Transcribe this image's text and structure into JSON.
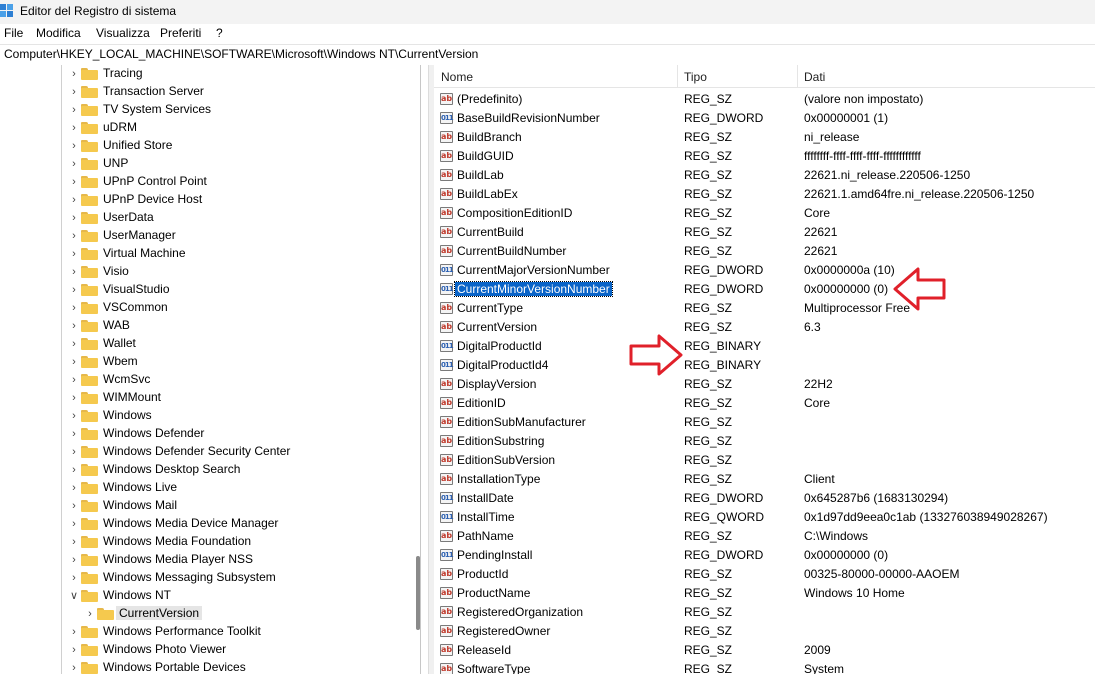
{
  "window": {
    "title": "Editor del Registro di sistema"
  },
  "menu": [
    "File",
    "Modifica",
    "Visualizza",
    "Preferiti",
    "?"
  ],
  "address": "Computer\\HKEY_LOCAL_MACHINE\\SOFTWARE\\Microsoft\\Windows NT\\CurrentVersion",
  "tree": [
    {
      "label": "Tracing",
      "expanded": false
    },
    {
      "label": "Transaction Server",
      "expanded": false
    },
    {
      "label": "TV System Services",
      "expanded": false
    },
    {
      "label": "uDRM",
      "expanded": false
    },
    {
      "label": "Unified Store",
      "expanded": false
    },
    {
      "label": "UNP",
      "expanded": false
    },
    {
      "label": "UPnP Control Point",
      "expanded": false
    },
    {
      "label": "UPnP Device Host",
      "expanded": false
    },
    {
      "label": "UserData",
      "expanded": false
    },
    {
      "label": "UserManager",
      "expanded": false
    },
    {
      "label": "Virtual Machine",
      "expanded": false
    },
    {
      "label": "Visio",
      "expanded": false
    },
    {
      "label": "VisualStudio",
      "expanded": false
    },
    {
      "label": "VSCommon",
      "expanded": false
    },
    {
      "label": "WAB",
      "expanded": false
    },
    {
      "label": "Wallet",
      "expanded": false
    },
    {
      "label": "Wbem",
      "expanded": false
    },
    {
      "label": "WcmSvc",
      "expanded": false
    },
    {
      "label": "WIMMount",
      "expanded": false
    },
    {
      "label": "Windows",
      "expanded": false
    },
    {
      "label": "Windows Defender",
      "expanded": false
    },
    {
      "label": "Windows Defender Security Center",
      "expanded": false
    },
    {
      "label": "Windows Desktop Search",
      "expanded": false
    },
    {
      "label": "Windows Live",
      "expanded": false
    },
    {
      "label": "Windows Mail",
      "expanded": false
    },
    {
      "label": "Windows Media Device Manager",
      "expanded": false
    },
    {
      "label": "Windows Media Foundation",
      "expanded": false
    },
    {
      "label": "Windows Media Player NSS",
      "expanded": false
    },
    {
      "label": "Windows Messaging Subsystem",
      "expanded": false
    },
    {
      "label": "Windows NT",
      "expanded": true
    },
    {
      "label": "CurrentVersion",
      "expanded": false,
      "child": true,
      "selected": true
    },
    {
      "label": "Windows Performance Toolkit",
      "expanded": false
    },
    {
      "label": "Windows Photo Viewer",
      "expanded": false
    },
    {
      "label": "Windows Portable Devices",
      "expanded": false
    }
  ],
  "columns": {
    "name": "Nome",
    "type": "Tipo",
    "data": "Dati"
  },
  "values": [
    {
      "name": "(Predefinito)",
      "type": "REG_SZ",
      "data": "(valore non impostato)",
      "kind": "sz"
    },
    {
      "name": "BaseBuildRevisionNumber",
      "type": "REG_DWORD",
      "data": "0x00000001 (1)",
      "kind": "bin"
    },
    {
      "name": "BuildBranch",
      "type": "REG_SZ",
      "data": "ni_release",
      "kind": "sz"
    },
    {
      "name": "BuildGUID",
      "type": "REG_SZ",
      "data": "ffffffff-ffff-ffff-ffff-ffffffffffff",
      "kind": "sz"
    },
    {
      "name": "BuildLab",
      "type": "REG_SZ",
      "data": "22621.ni_release.220506-1250",
      "kind": "sz"
    },
    {
      "name": "BuildLabEx",
      "type": "REG_SZ",
      "data": "22621.1.amd64fre.ni_release.220506-1250",
      "kind": "sz"
    },
    {
      "name": "CompositionEditionID",
      "type": "REG_SZ",
      "data": "Core",
      "kind": "sz"
    },
    {
      "name": "CurrentBuild",
      "type": "REG_SZ",
      "data": "22621",
      "kind": "sz"
    },
    {
      "name": "CurrentBuildNumber",
      "type": "REG_SZ",
      "data": "22621",
      "kind": "sz"
    },
    {
      "name": "CurrentMajorVersionNumber",
      "type": "REG_DWORD",
      "data": "0x0000000a (10)",
      "kind": "bin"
    },
    {
      "name": "CurrentMinorVersionNumber",
      "type": "REG_DWORD",
      "data": "0x00000000 (0)",
      "kind": "bin",
      "selected": true
    },
    {
      "name": "CurrentType",
      "type": "REG_SZ",
      "data": "Multiprocessor Free",
      "kind": "sz"
    },
    {
      "name": "CurrentVersion",
      "type": "REG_SZ",
      "data": "6.3",
      "kind": "sz"
    },
    {
      "name": "DigitalProductId",
      "type": "REG_BINARY",
      "data": "",
      "kind": "bin"
    },
    {
      "name": "DigitalProductId4",
      "type": "REG_BINARY",
      "data": "",
      "kind": "bin"
    },
    {
      "name": "DisplayVersion",
      "type": "REG_SZ",
      "data": "22H2",
      "kind": "sz"
    },
    {
      "name": "EditionID",
      "type": "REG_SZ",
      "data": "Core",
      "kind": "sz"
    },
    {
      "name": "EditionSubManufacturer",
      "type": "REG_SZ",
      "data": "",
      "kind": "sz"
    },
    {
      "name": "EditionSubstring",
      "type": "REG_SZ",
      "data": "",
      "kind": "sz"
    },
    {
      "name": "EditionSubVersion",
      "type": "REG_SZ",
      "data": "",
      "kind": "sz"
    },
    {
      "name": "InstallationType",
      "type": "REG_SZ",
      "data": "Client",
      "kind": "sz"
    },
    {
      "name": "InstallDate",
      "type": "REG_DWORD",
      "data": "0x645287b6 (1683130294)",
      "kind": "bin"
    },
    {
      "name": "InstallTime",
      "type": "REG_QWORD",
      "data": "0x1d97dd9eea0c1ab (133276038949028267)",
      "kind": "bin"
    },
    {
      "name": "PathName",
      "type": "REG_SZ",
      "data": "C:\\Windows",
      "kind": "sz"
    },
    {
      "name": "PendingInstall",
      "type": "REG_DWORD",
      "data": "0x00000000 (0)",
      "kind": "bin"
    },
    {
      "name": "ProductId",
      "type": "REG_SZ",
      "data": "00325-80000-00000-AAOEM",
      "kind": "sz"
    },
    {
      "name": "ProductName",
      "type": "REG_SZ",
      "data": "Windows 10 Home",
      "kind": "sz"
    },
    {
      "name": "RegisteredOrganization",
      "type": "REG_SZ",
      "data": "",
      "kind": "sz"
    },
    {
      "name": "RegisteredOwner",
      "type": "REG_SZ",
      "data": "",
      "kind": "sz"
    },
    {
      "name": "ReleaseId",
      "type": "REG_SZ",
      "data": "2009",
      "kind": "sz"
    },
    {
      "name": "SoftwareType",
      "type": "REG_SZ",
      "data": "System",
      "kind": "sz"
    }
  ],
  "colors": {
    "selection": "#0a64c8",
    "annotation_arrow": "#e0202a",
    "folder": "#f5c94e"
  }
}
